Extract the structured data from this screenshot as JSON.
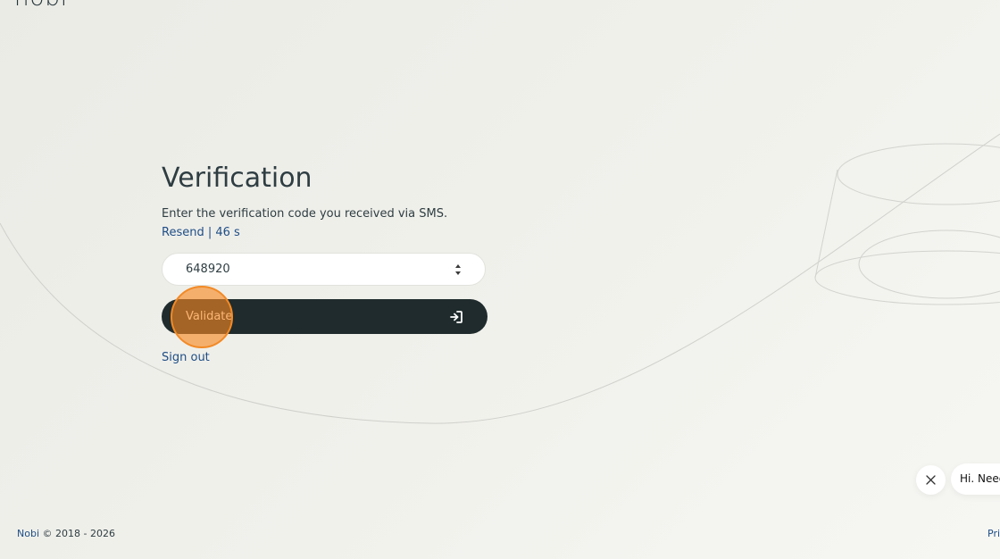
{
  "brand": {
    "logo_text": "nobi"
  },
  "verification": {
    "title": "Verification",
    "instructions": "Enter the verification code you received via SMS.",
    "resend_label": "Resend | 46 s",
    "code_value": "648920",
    "validate_label": "Validate",
    "sign_out_label": "Sign out"
  },
  "chat": {
    "greeting": "Hi. Need"
  },
  "footer": {
    "brand": "Nobi",
    "copyright": " © 2018 - 2026",
    "privacy_partial": "Pri"
  },
  "colors": {
    "button_bg": "#1f2b2d",
    "link": "#1e4e86",
    "click_marker": "#f28a26"
  },
  "icons": [
    "spinner-icon",
    "login-icon",
    "close-icon"
  ]
}
